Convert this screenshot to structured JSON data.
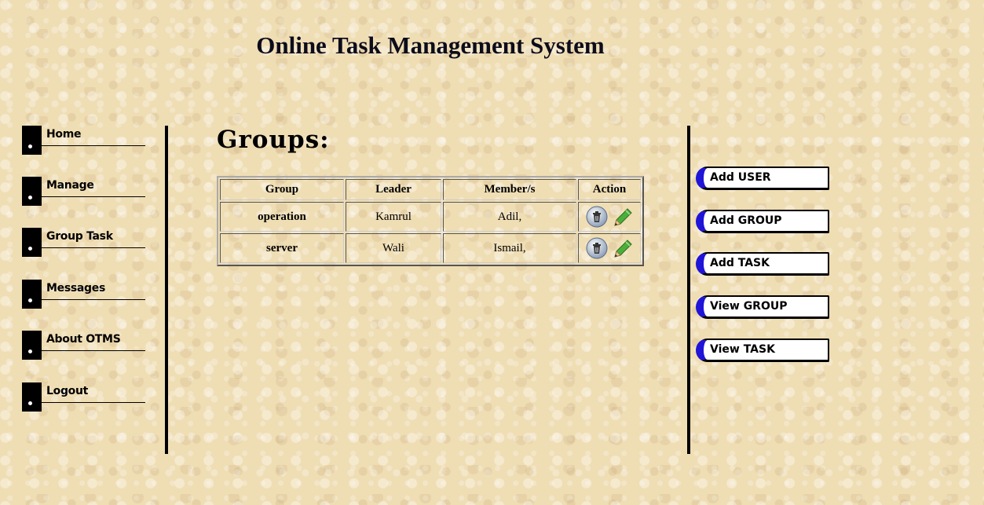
{
  "title": "Online Task Management System",
  "left_nav": [
    "Home",
    "Manage",
    "Group Task",
    "Messages",
    "About OTMS",
    "Logout"
  ],
  "main": {
    "heading": "Groups:",
    "columns": [
      "Group",
      "Leader",
      "Member/s",
      "Action"
    ],
    "rows": [
      {
        "group": "operation",
        "leader": "Kamrul",
        "members": "Adil,"
      },
      {
        "group": "server",
        "leader": "Wali",
        "members": "Ismail,"
      }
    ]
  },
  "right_nav": [
    "Add USER",
    "Add GROUP",
    "Add TASK",
    "View GROUP",
    "View TASK"
  ],
  "colors": {
    "accent": "#1f14d8",
    "background": "#efddb4"
  }
}
